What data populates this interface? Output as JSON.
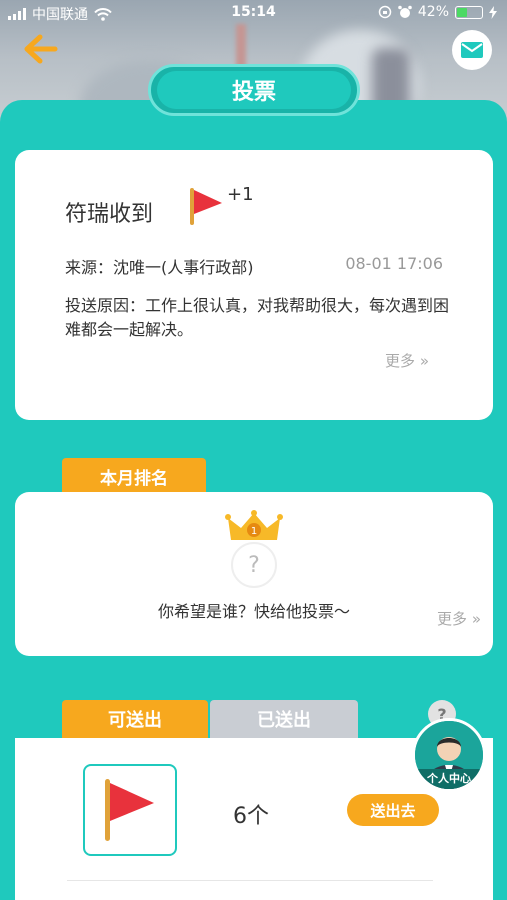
{
  "status_bar": {
    "carrier": "中国联通",
    "time": "15:14",
    "battery": "42%",
    "battery_level": 0.42
  },
  "header": {
    "title": "投票"
  },
  "received": {
    "name": "符瑞收到",
    "plus": "+1",
    "source": "来源：沈唯一(人事行政部)",
    "date": "08-01 17:06",
    "reason": "投送原因：工作上很认真，对我帮助很大，每次遇到困难都会一起解决。",
    "more": "更多 »"
  },
  "ranking": {
    "tag": "本月排名",
    "rank": "1",
    "placeholder": "?",
    "hint": "你希望是谁？快给他投票～",
    "more": "更多 »"
  },
  "tabs": [
    {
      "label": "可送出",
      "active": true
    },
    {
      "label": "已送出",
      "active": false
    }
  ],
  "help": "?",
  "sendable": {
    "count": "6个",
    "send_button": "送出去"
  },
  "profile": {
    "label": "个人中心"
  },
  "colors": {
    "teal": "#1fc9bd",
    "orange": "#f7a81e",
    "flag_red": "#e8323c"
  }
}
